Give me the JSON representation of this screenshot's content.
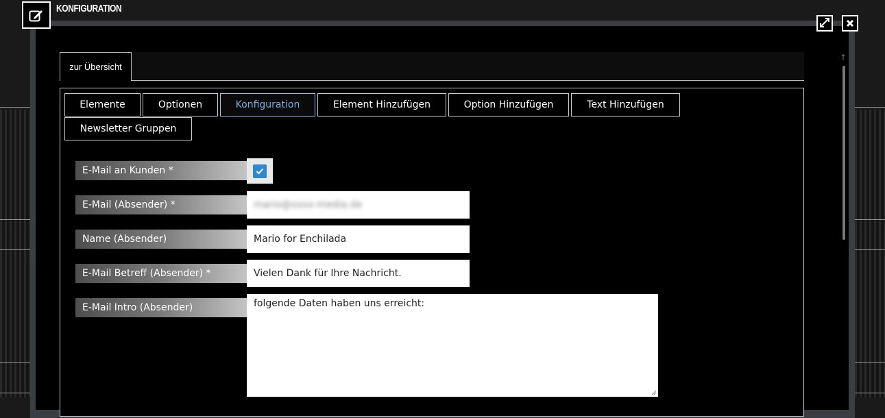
{
  "window": {
    "title": "KONFIGURATION",
    "icons": {
      "title": "edit-icon",
      "maximize": "expand-icon",
      "close": "close-icon"
    }
  },
  "top_tab": {
    "label": "zur Übersicht"
  },
  "tabs": [
    {
      "label": "Elemente",
      "active": false
    },
    {
      "label": "Optionen",
      "active": false
    },
    {
      "label": "Konfiguration",
      "active": true
    },
    {
      "label": "Element Hinzufügen",
      "active": false
    },
    {
      "label": "Option Hinzufügen",
      "active": false
    },
    {
      "label": "Text Hinzufügen",
      "active": false
    },
    {
      "label": "Newsletter Gruppen",
      "active": false
    }
  ],
  "form": {
    "email_customers": {
      "label": "E-Mail an Kunden *",
      "checked": true
    },
    "email_sender": {
      "label": "E-Mail (Absender) *",
      "value": "mario@xxxx-media.de"
    },
    "name_sender": {
      "label": "Name (Absender)",
      "value": "Mario for Enchilada"
    },
    "subject_sender": {
      "label": "E-Mail Betreff (Absender) *",
      "value": "Vielen Dank für Ihre Nachricht."
    },
    "intro_sender": {
      "label": "E-Mail Intro (Absender)",
      "value": "folgende Daten haben uns erreicht:"
    }
  },
  "colors": {
    "active_tab": "#7aaee6",
    "checkbox": "#2f87d0"
  }
}
